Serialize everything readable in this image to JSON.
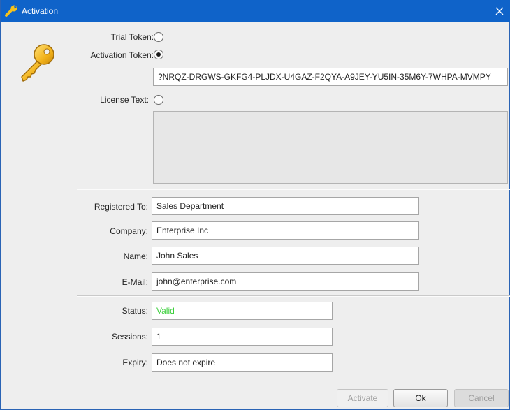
{
  "window": {
    "title": "Activation"
  },
  "options": {
    "trial_label": "Trial Token:",
    "activation_label": "Activation Token:",
    "license_label": "License Text:",
    "selected": "activation"
  },
  "activation_token": "?NRQZ-DRGWS-GKFG4-PLJDX-U4GAZ-F2QYA-A9JEY-YU5IN-35M6Y-7WHPA-MVMPY",
  "license_text": "",
  "registration": {
    "registered_to_label": "Registered To:",
    "registered_to": "Sales Department",
    "company_label": "Company:",
    "company": "Enterprise Inc",
    "name_label": "Name:",
    "name": "John Sales",
    "email_label": "E-Mail:",
    "email": "john@enterprise.com"
  },
  "status": {
    "status_label": "Status:",
    "status_value": "Valid",
    "status_color": "#3ccf3c",
    "sessions_label": "Sessions:",
    "sessions_value": "1",
    "expiry_label": "Expiry:",
    "expiry_value": "Does not expire"
  },
  "buttons": {
    "activate": "Activate",
    "ok": "Ok",
    "cancel": "Cancel"
  },
  "colors": {
    "titlebar": "#0f63c9",
    "window_bg": "#eeeeee",
    "key_icon": "#f2b21a"
  },
  "icons": {
    "title_icon": "wrench-icon",
    "key": "key-icon",
    "close": "close-icon"
  }
}
